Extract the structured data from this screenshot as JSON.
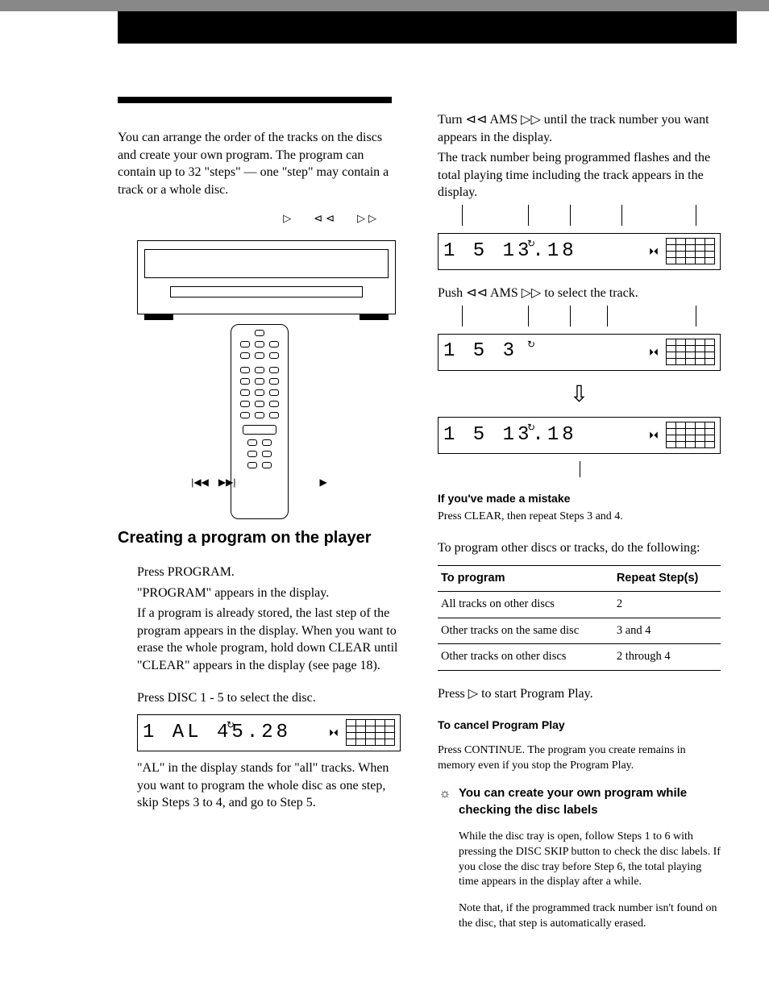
{
  "icons": {
    "play": "▷",
    "prev": "⊲⊲",
    "next": "▷▷",
    "prev_bar": "|◀◀",
    "next_bar": "▶▶|",
    "ams_prev": "⊲⊲",
    "ams_next": "▷▷",
    "repeat": "↻",
    "tape": "⏵⏴",
    "tip": "☼",
    "arrow_down": "⇩"
  },
  "left": {
    "intro": "You can arrange the order of the tracks on the discs and create your own program. The program can contain up to 32 \"steps\" — one \"step\" may contain a track or a whole disc.",
    "heading": "Creating a program on the player",
    "step1_l1": "Press PROGRAM.",
    "step1_l2": "\"PROGRAM\" appears in the display.",
    "step1_l3": "If a program is already stored, the last step of the program appears in the display. When you want to erase the whole program, hold down CLEAR until \"CLEAR\" appears in the display (see page 18).",
    "step2_l1": "Press DISC 1 - 5 to select the disc.",
    "lcd2_text": "1  AL  45.28",
    "step2_note": "\"AL\" in the display stands for \"all\" tracks. When you want to program the whole disc as one step, skip Steps 3 to 4, and go to Step 5."
  },
  "right": {
    "step3_l1_a": "Turn ",
    "step3_l1_b": " AMS ",
    "step3_l1_c": " until the track number you want appears in the display.",
    "step3_l2": "The track number being programmed flashes and the total playing time including the track appears in the display.",
    "lcd3a_text": "1   5  13.18",
    "step4_l1_a": "Push ",
    "step4_l1_b": " AMS ",
    "step4_l1_c": " to select the track.",
    "lcd4a_text": "1   5   3",
    "lcd4b_text": "1   5  13.18",
    "mistake_h": "If you've made a mistake",
    "mistake_b": "Press CLEAR, then repeat Steps 3 and 4.",
    "step5_l1": "To program other discs or tracks, do the following:",
    "table": {
      "h1": "To program",
      "h2": "Repeat Step(s)",
      "rows": [
        {
          "c1": "All tracks on other discs",
          "c2": "2"
        },
        {
          "c1": "Other tracks on the same disc",
          "c2": "3 and 4"
        },
        {
          "c1": "Other tracks on other discs",
          "c2": "2 through 4"
        }
      ]
    },
    "step6_a": "Press ",
    "step6_b": " to start Program Play.",
    "cancel_h": "To cancel Program Play",
    "cancel_b": "Press CONTINUE. The program you create remains in memory even if you stop the Program Play.",
    "tip_h": "You can create your own program while checking the disc labels",
    "tip_b1": "While the disc tray is open, follow Steps 1 to 6 with pressing the DISC SKIP button to check the disc labels. If you close the disc tray before Step 6, the total playing time appears in the display after a while.",
    "tip_b2": "Note that, if the programmed track number isn't found on the disc, that step is automatically erased."
  }
}
